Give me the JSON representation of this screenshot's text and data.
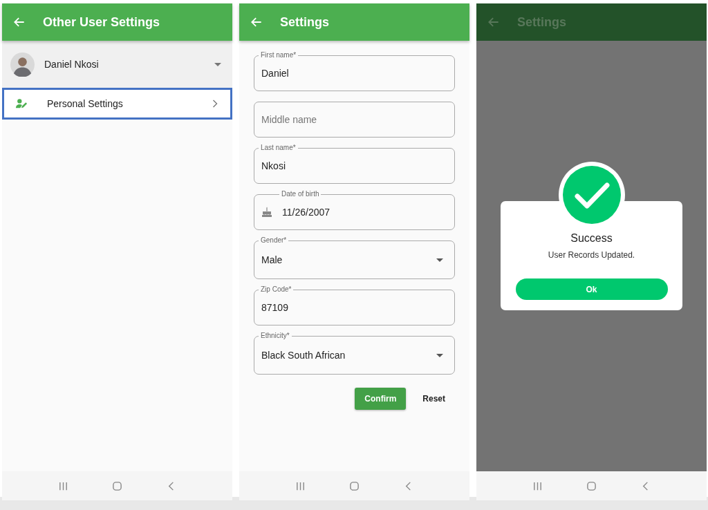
{
  "screens": [
    {
      "kind": "list",
      "dimmed": false,
      "title": "Other User Settings",
      "user": {
        "name": "Daniel Nkosi"
      },
      "items": [
        {
          "label": "Personal Settings",
          "selected": true
        }
      ]
    },
    {
      "kind": "form",
      "dimmed": false,
      "title": "Settings",
      "fields": [
        {
          "kind": "text",
          "label": "First name*",
          "value": "Daniel"
        },
        {
          "kind": "text",
          "placeholder": "Middle name"
        },
        {
          "kind": "text",
          "label": "Last name*",
          "value": "Nkosi"
        },
        {
          "kind": "date",
          "label": "Date of birth",
          "value": "11/26/2007"
        },
        {
          "kind": "select",
          "label": "Gender*",
          "value": "Male"
        },
        {
          "kind": "text",
          "label": "Zip Code*",
          "value": "87109"
        },
        {
          "kind": "select",
          "label": "Ethnicity*",
          "value": "Black South African"
        }
      ],
      "buttons": [
        {
          "kind": "filled",
          "label": "Confirm"
        },
        {
          "kind": "text",
          "label": "Reset"
        }
      ]
    },
    {
      "kind": "dialog",
      "dimmed": true,
      "title": "Settings",
      "dialog": {
        "title": "Success",
        "message": "User Records Updated.",
        "button": "Ok"
      }
    }
  ]
}
